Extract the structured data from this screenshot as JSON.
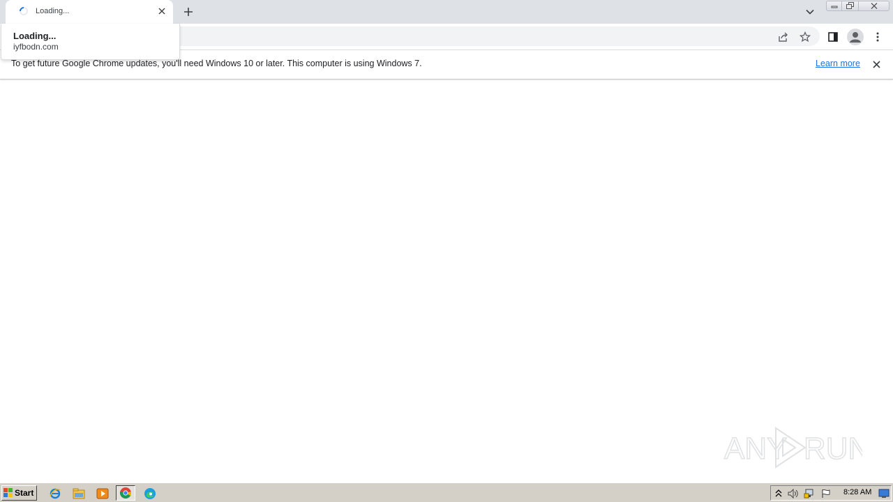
{
  "tab": {
    "title": "Loading...",
    "close_icon": "close-icon",
    "spinner_icon": "loading-spinner-icon"
  },
  "tabstrip": {
    "new_tab_icon": "plus-icon",
    "tab_search_icon": "chevron-down-icon"
  },
  "window_controls": [
    "minimize-icon",
    "restore-icon",
    "close-icon"
  ],
  "toolbar": {
    "icons": [
      "share-icon",
      "star-icon",
      "side-panel-icon",
      "profile-avatar-icon",
      "more-vert-icon"
    ]
  },
  "hovercard": {
    "title": "Loading...",
    "domain": "iyfbodn.com"
  },
  "infobar": {
    "message": "To get future Google Chrome updates, you'll need Windows 10 or later. This computer is using Windows 7.",
    "link": "Learn more",
    "close_icon": "close-icon"
  },
  "watermark": {
    "text_left": "ANY",
    "text_right": "RUN"
  },
  "taskbar": {
    "start_label": "Start",
    "apps": [
      "internet-explorer-icon",
      "file-explorer-icon",
      "media-player-icon",
      "chrome-icon",
      "edge-icon"
    ],
    "tray_icons": [
      "show-hidden-icons-icon",
      "volume-icon",
      "network-icon",
      "action-center-flag-icon"
    ],
    "clock": "8:28 AM",
    "show_desktop_icon": "show-desktop-icon"
  },
  "colors": {
    "tabstrip_bg": "#dee1e6",
    "accent": "#1a73e8",
    "taskbar_bg": "#d4d0c8"
  }
}
